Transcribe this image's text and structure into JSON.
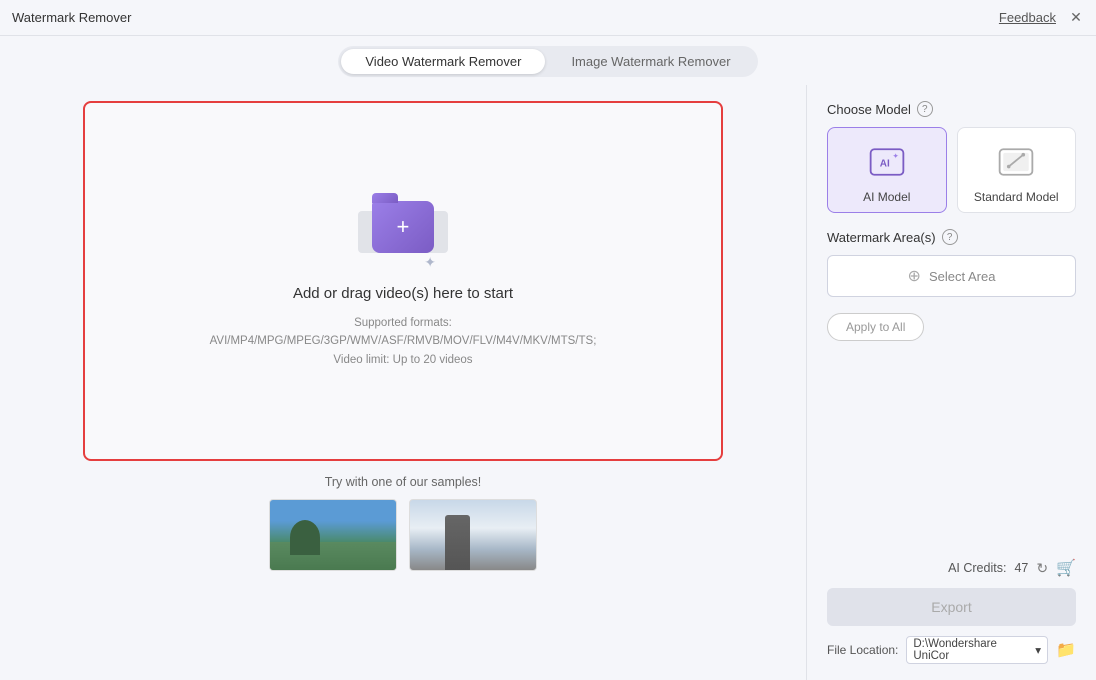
{
  "titlebar": {
    "app_name": "Watermark Remover",
    "feedback_label": "Feedback",
    "close_icon": "✕"
  },
  "tabs": {
    "video_label": "Video Watermark Remover",
    "image_label": "Image Watermark Remover",
    "active": "video"
  },
  "dropzone": {
    "title": "Add or drag video(s) here to start",
    "formats_line1": "Supported formats:",
    "formats_line2": "AVI/MP4/MPG/MPEG/3GP/WMV/ASF/RMVB/MOV/FLV/M4V/MKV/MTS/TS;",
    "formats_line3": "Video limit: Up to 20 videos",
    "plus_icon": "+"
  },
  "samples": {
    "label": "Try with one of our samples!"
  },
  "right_panel": {
    "choose_model_label": "Choose Model",
    "watermark_areas_label": "Watermark Area(s)",
    "ai_model_label": "AI Model",
    "standard_model_label": "Standard Model",
    "select_area_label": "Select Area",
    "apply_all_label": "Apply to All",
    "ai_credits_label": "AI Credits:",
    "ai_credits_value": "47",
    "export_label": "Export",
    "file_location_label": "File Location:",
    "file_location_value": "D:\\Wondershare UniCor"
  }
}
